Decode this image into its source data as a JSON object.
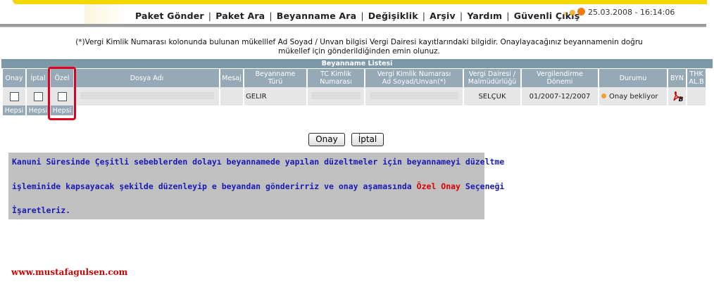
{
  "nav": {
    "items": [
      "Paket Gönder",
      "Paket Ara",
      "Beyanname Ara",
      "Değişiklik",
      "Arşiv",
      "Yardım",
      "Güvenli Çıkış"
    ],
    "separator": "|"
  },
  "datetime": "25.03.2008 - 16:14:06",
  "note": {
    "line1": "(*)Vergi Kimlik Numarası kolonunda bulunan mükelllef Ad Soyad / Unvan bilgisi Vergi Dairesi kayıtlarındaki bilgidir. Onaylayacağınız beyannamenin doğru",
    "line2": "mükellef için gönderildiğinden emin olunuz."
  },
  "list": {
    "title": "Beyanname Listesi",
    "headers": {
      "onay": "Onay",
      "iptal": "İptal",
      "ozel": "Özel",
      "dosya": "Dosya Adı",
      "mesaj": "Mesaj",
      "tur_1": "Beyanname",
      "tur_2": "Türü",
      "tc_1": "TC Kimlik",
      "tc_2": "Numarası",
      "vkn_1": "Vergi Kimlik Numarası",
      "vkn_2": "Ad Soyad/Unvan(*)",
      "vd_1": "Vergi Dairesi /",
      "vd_2": "Malmüdürlüğü",
      "donem_1": "Vergilendirme",
      "donem_2": "Dönemi",
      "durum": "Durumu",
      "byn": "BYN",
      "thk_1": "THK",
      "thk_2": "AL.B"
    },
    "row": {
      "tur": "GELIR",
      "vergi_dairesi": "SELÇUK",
      "donem": "01/2007-12/2007",
      "durum": "Onay bekliyor",
      "pdf_letter": "B"
    },
    "select_all": [
      "Hepsi",
      "Hepsi",
      "Hepsi"
    ]
  },
  "buttons": {
    "onay": "Onay",
    "iptal": "İptal"
  },
  "info": {
    "line1": "Kanuni Süresinde Çeşitli sebeblerden dolayı beyannamede yapılan düzeltmeler için beyannameyi düzeltme",
    "line2_pre": "işleminide kapsayacak şekilde düzenleyip e beyandan gönderirriz ve onay aşamasında ",
    "line2_red": "Özel Onay",
    "line2_post": " Seçeneği",
    "line3": "İşaretleriz."
  },
  "website": "www.mustafagulsen.com",
  "colors": {
    "header_bg": "#95aab6",
    "title_bg": "#7b99a8",
    "highlight": "#e0001b",
    "info_text": "#1a1ab8",
    "accent": "#f4d600"
  }
}
